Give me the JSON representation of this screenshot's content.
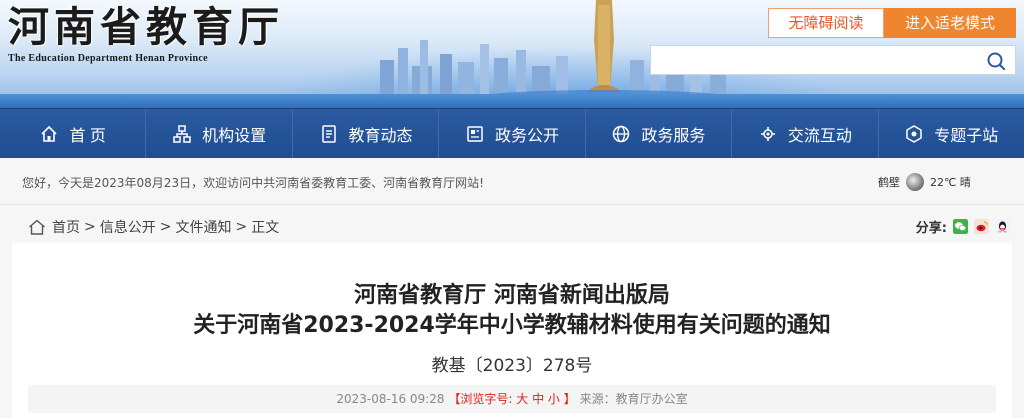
{
  "header": {
    "site_name_cn": "河南省教育厅",
    "site_name_en": "The Education Department Henan Province",
    "accessibility_label": "无障碍阅读",
    "elder_mode_label": "进入适老模式",
    "search": {
      "placeholder": "",
      "value": "",
      "icon": "search-icon"
    }
  },
  "nav": {
    "items": [
      {
        "label": "首 页",
        "icon": "home-icon"
      },
      {
        "label": "机构设置",
        "icon": "org-chart-icon"
      },
      {
        "label": "教育动态",
        "icon": "document-icon"
      },
      {
        "label": "政务公开",
        "icon": "newspaper-icon"
      },
      {
        "label": "政务服务",
        "icon": "globe-icon"
      },
      {
        "label": "交流互动",
        "icon": "interaction-icon"
      },
      {
        "label": "专题子站",
        "icon": "topic-icon"
      }
    ]
  },
  "notice": {
    "welcome": "您好，今天是2023年08月23日，欢迎访问中共河南省委教育工委、河南省教育厅网站!",
    "weather_city": "鹤壁",
    "weather_temp": "22℃ 晴"
  },
  "breadcrumb": {
    "items": [
      "首页",
      "信息公开",
      "文件通知",
      "正文"
    ],
    "separator": ">"
  },
  "share": {
    "label": "分享:",
    "icons": [
      "wechat-icon",
      "weibo-icon",
      "qq-icon"
    ]
  },
  "article": {
    "title_line1": "河南省教育厅 河南省新闻出版局",
    "title_line2": "关于河南省2023-2024学年中小学教辅材料使用有关问题的通知",
    "doc_number": "教基〔2023〕278号",
    "date": "2023-08-16 09:28",
    "font_size_prefix": "【浏览字号:",
    "font_size_large": "大",
    "font_size_medium": "中",
    "font_size_small": "小",
    "font_size_suffix": "】",
    "source": "来源：教育厅办公室"
  },
  "colors": {
    "nav_bg": "#2b5ba0",
    "accent_orange": "#f08530",
    "accent_red": "#e02020"
  }
}
